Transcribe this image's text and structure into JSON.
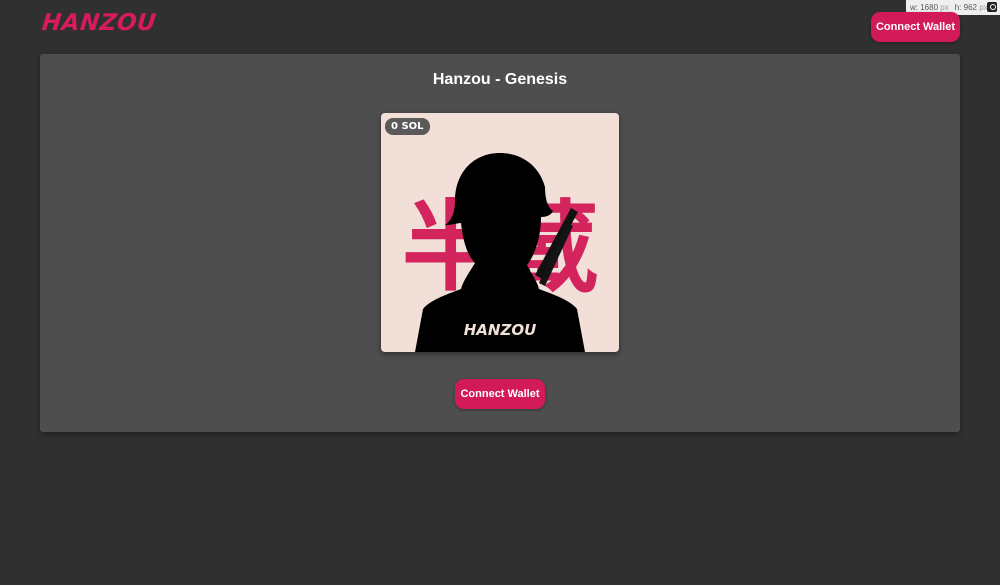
{
  "header": {
    "logo_text": "HANZOU",
    "connect_label": "Connect Wallet"
  },
  "devtools": {
    "width_label": "w: 1680",
    "height_label": "h: 962",
    "unit": "px"
  },
  "collection": {
    "title": "Hanzou - Genesis",
    "price_badge": "0 SOL",
    "artwork": {
      "kanji": "半蔵",
      "shirt_text": "HANZOU"
    },
    "connect_label": "Connect Wallet"
  },
  "colors": {
    "accent": "#d21a58",
    "page_bg": "#303030",
    "card_bg": "#4e4e4e",
    "art_bg": "#f2e0d8",
    "kanji": "#d3245d"
  }
}
